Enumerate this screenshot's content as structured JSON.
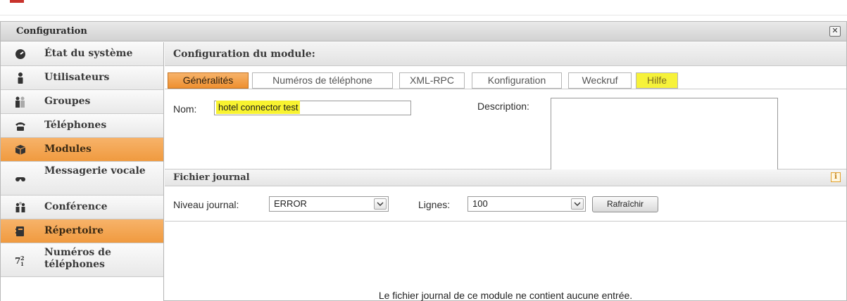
{
  "window": {
    "title": "Configuration"
  },
  "sidebar": {
    "items": [
      {
        "label": "État du système",
        "icon": "dashboard-icon"
      },
      {
        "label": "Utilisateurs",
        "icon": "user-icon"
      },
      {
        "label": "Groupes",
        "icon": "group-icon"
      },
      {
        "label": "Téléphones",
        "icon": "phone-icon"
      },
      {
        "label": "Modules",
        "icon": "cube-icon"
      },
      {
        "label": "Messagerie vocale",
        "icon": "voicemail-icon"
      },
      {
        "label": "Conférence",
        "icon": "conference-icon"
      },
      {
        "label": "Répertoire",
        "icon": "address-book-icon"
      },
      {
        "label": "Numéros de téléphones",
        "icon": "numbers-icon"
      }
    ],
    "active": "Modules",
    "highlighted": "Répertoire"
  },
  "module": {
    "header": "Configuration du module:",
    "tabs": [
      "Généralités",
      "Numéros de téléphone",
      "XML-RPC",
      "Konfiguration",
      "Weckruf",
      "Hilfe"
    ],
    "active_tab": "Généralités",
    "name_label": "Nom:",
    "name_value": "hotel connector test",
    "description_label": "Description:"
  },
  "log": {
    "header": "Fichier journal",
    "level_label": "Niveau journal:",
    "level_value": "ERROR",
    "lines_label": "Lignes:",
    "lines_value": "100",
    "refresh_label": "Rafraîchir",
    "empty_message": "Le fichier journal de ce module ne contient aucune entrée."
  },
  "colors": {
    "accent": "#f09a3f",
    "highlight": "#f8f330"
  }
}
